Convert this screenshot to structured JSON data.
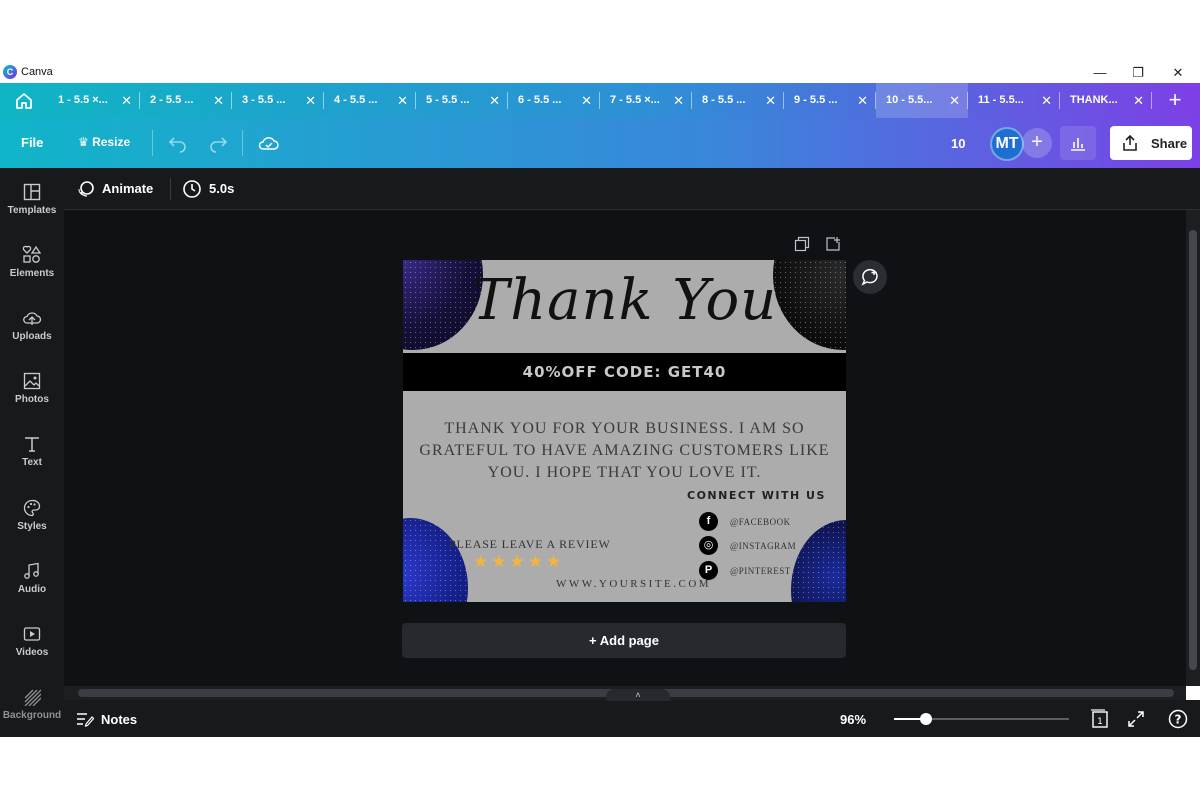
{
  "window": {
    "app_name": "Canva",
    "minimize_glyph": "—",
    "maximize_glyph": "❐",
    "close_glyph": "✕"
  },
  "tabs": [
    {
      "label": "1 - 5.5 ×..."
    },
    {
      "label": "2 - 5.5 ..."
    },
    {
      "label": "3 - 5.5 ..."
    },
    {
      "label": "4 - 5.5 ..."
    },
    {
      "label": "5 - 5.5 ..."
    },
    {
      "label": "6 - 5.5 ..."
    },
    {
      "label": "7 - 5.5 ×..."
    },
    {
      "label": "8 - 5.5 ..."
    },
    {
      "label": "9 - 5.5 ..."
    },
    {
      "label": "10 - 5.5..."
    },
    {
      "label": "11 - 5.5..."
    },
    {
      "label": "THANK..."
    }
  ],
  "active_tab_index": 9,
  "tab_close_glyph": "✕",
  "new_tab_glyph": "+",
  "toolbar": {
    "file_label": "File",
    "resize_label": "♛ Resize",
    "page_count": "10",
    "avatar_initials": "MT",
    "add_collaborator_glyph": "+",
    "share_label": "Share"
  },
  "sidebar": {
    "items": [
      {
        "label": "Templates",
        "icon": "templates-icon"
      },
      {
        "label": "Elements",
        "icon": "elements-icon"
      },
      {
        "label": "Uploads",
        "icon": "uploads-icon"
      },
      {
        "label": "Photos",
        "icon": "photos-icon"
      },
      {
        "label": "Text",
        "icon": "text-icon"
      },
      {
        "label": "Styles",
        "icon": "styles-icon"
      },
      {
        "label": "Audio",
        "icon": "audio-icon"
      },
      {
        "label": "Videos",
        "icon": "videos-icon"
      },
      {
        "label": "Background",
        "icon": "background-icon"
      }
    ]
  },
  "editor_bar": {
    "animate_label": "Animate",
    "duration_label": "5.0s"
  },
  "design": {
    "title": "Thank You",
    "code_text": "40%OFF CODE: GET40",
    "message": "THANK YOU FOR YOUR BUSINESS. I AM SO GRATEFUL TO HAVE AMAZING CUSTOMERS LIKE YOU. I HOPE THAT YOU LOVE IT.",
    "connect_title": "CONNECT WITH US",
    "socials": [
      {
        "glyph": "f",
        "handle": "@FACEBOOK",
        "icon": "facebook-icon"
      },
      {
        "glyph": "◎",
        "handle": "@INSTAGRAM",
        "icon": "instagram-icon"
      },
      {
        "glyph": "P",
        "handle": "@PINTEREST",
        "icon": "pinterest-icon"
      }
    ],
    "review_text": "PLEASE LEAVE A REVIEW",
    "stars": "★★★★★",
    "rating": 5,
    "website": "WWW.YOURSITE.COM"
  },
  "add_page_label": "+ Add page",
  "bottombar": {
    "collapse_glyph": "˄",
    "notes_label": "Notes",
    "zoom_label": "96%",
    "zoom_fraction": 0.18,
    "page_indicator": "1",
    "help_glyph": "?"
  },
  "colors": {
    "accent_teal": "#0fb5c4",
    "accent_purple": "#7e3fe6",
    "editor_bg": "#0f1215",
    "panel_bg": "#18191b",
    "star_gold": "#f3b53c"
  }
}
